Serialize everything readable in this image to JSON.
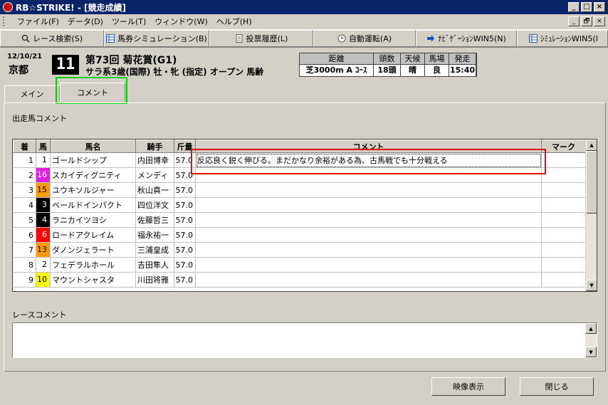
{
  "window": {
    "title": "RB☆STRIKE! - [競走成績]",
    "buttons": [
      "_",
      "□",
      "×"
    ],
    "mdi_buttons": [
      "_",
      "🗗",
      "×"
    ]
  },
  "menu": [
    "ファイル(F)",
    "データ(D)",
    "ツール(T)",
    "ウィンドウ(W)",
    "ヘルプ(H)"
  ],
  "toolbar": [
    {
      "label": "レース検索(S)",
      "icon": "search-icon"
    },
    {
      "label": "馬券シミュレーション(B)",
      "icon": "table-icon"
    },
    {
      "label": "投票履歴(L)",
      "icon": "document-icon"
    },
    {
      "label": "自動運転(A)",
      "icon": "clock-icon"
    },
    {
      "label": "ﾅﾋﾞｹﾞｰｼｮﾝWIN5(N)",
      "icon": "arrow-icon"
    },
    {
      "label": "ｼﾐｭﾚｰｼｮﾝWIN5(I",
      "icon": "table-icon"
    }
  ],
  "race": {
    "date": "12/10/21",
    "venue": "京都",
    "number": "11",
    "name": "第73回 菊花賞(G1)",
    "conditions": "サラ系3歳(国際) 牡・牝 (指定) オープン 馬齢",
    "info_headers": [
      "距離",
      "頭数",
      "天候",
      "馬場",
      "発走"
    ],
    "info_values": [
      "芝3000m A ｺｰｽ",
      "18頭",
      "晴",
      "良",
      "15:40"
    ]
  },
  "tabs": [
    "メイン",
    "コメント"
  ],
  "entries_label": "出走馬コメント",
  "columns": [
    "着",
    "馬",
    "馬名",
    "騎手",
    "斤量",
    "コメント",
    "マーク"
  ],
  "rows": [
    {
      "rank": "1",
      "num": "1",
      "color": "#ffffff",
      "fg": "#000000",
      "name": "ゴールドシップ",
      "jockey": "内田博幸",
      "weight": "57.0",
      "comment": "反応良く鋭く伸びる。まだかなり余裕がある為、古馬戦でも十分戦える",
      "mark": ""
    },
    {
      "rank": "2",
      "num": "16",
      "color": "#e020e0",
      "fg": "#ffffff",
      "name": "スカイディグニティ",
      "jockey": "メンディ",
      "weight": "57.0",
      "comment": "",
      "mark": ""
    },
    {
      "rank": "3",
      "num": "15",
      "color": "#ff9a00",
      "fg": "#000000",
      "name": "ユウキソルジャー",
      "jockey": "秋山真一",
      "weight": "57.0",
      "comment": "",
      "mark": ""
    },
    {
      "rank": "4",
      "num": "3",
      "color": "#000000",
      "fg": "#ffffff",
      "name": "ベールドインパクト",
      "jockey": "四位洋文",
      "weight": "57.0",
      "comment": "",
      "mark": ""
    },
    {
      "rank": "5",
      "num": "4",
      "color": "#000000",
      "fg": "#ffffff",
      "name": "ラニカイツヨシ",
      "jockey": "佐藤哲三",
      "weight": "57.0",
      "comment": "",
      "mark": ""
    },
    {
      "rank": "6",
      "num": "6",
      "color": "#ff0000",
      "fg": "#ffffff",
      "name": "ロードアクレイム",
      "jockey": "福永祐一",
      "weight": "57.0",
      "comment": "",
      "mark": ""
    },
    {
      "rank": "7",
      "num": "13",
      "color": "#ff9a00",
      "fg": "#000000",
      "name": "ダノンジェラート",
      "jockey": "三浦皇成",
      "weight": "57.0",
      "comment": "",
      "mark": ""
    },
    {
      "rank": "8",
      "num": "2",
      "color": "#ffffff",
      "fg": "#000000",
      "name": "フェデラルホール",
      "jockey": "吉田隼人",
      "weight": "57.0",
      "comment": "",
      "mark": ""
    },
    {
      "rank": "9",
      "num": "10",
      "color": "#ffff00",
      "fg": "#000000",
      "name": "マウントシャスタ",
      "jockey": "川田将雅",
      "weight": "57.0",
      "comment": "",
      "mark": ""
    }
  ],
  "race_comment_label": "レースコメント",
  "race_comment": "",
  "buttons": {
    "video": "映像表示",
    "close": "閉じる"
  }
}
